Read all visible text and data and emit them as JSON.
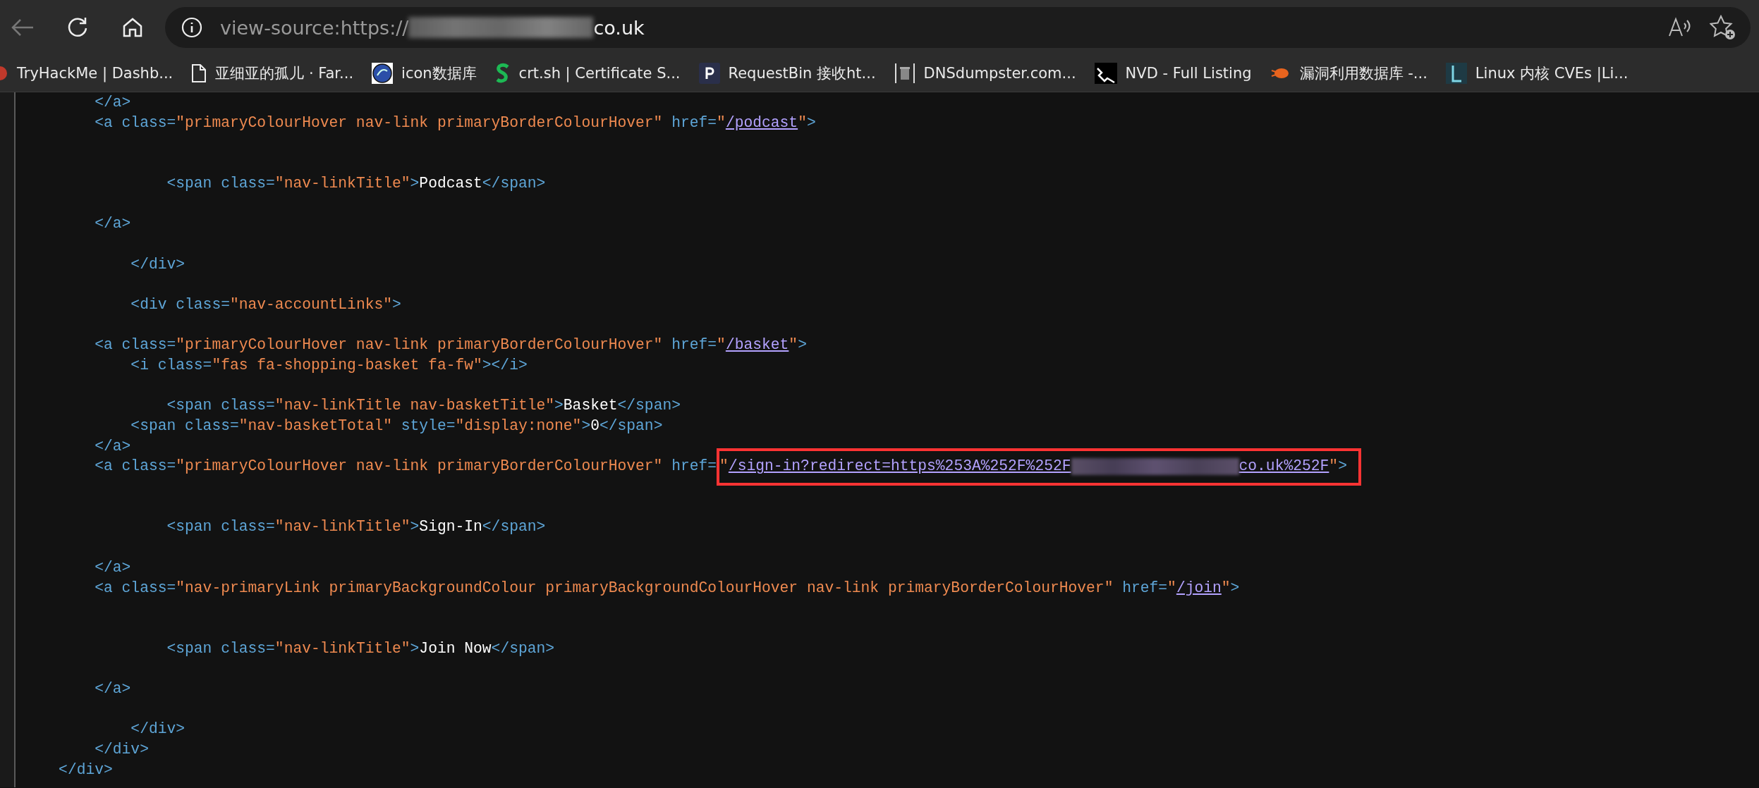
{
  "toolbar": {
    "address": {
      "scheme": "view-source:https:",
      "host_start": "//",
      "host_end": "co.uk"
    }
  },
  "bookmarks": [
    {
      "label": "TryHackMe | Dashb..."
    },
    {
      "label": "亚细亚的孤儿 · Far..."
    },
    {
      "label": "icon数据库"
    },
    {
      "label": "crt.sh | Certificate S..."
    },
    {
      "label": "RequestBin   接收ht..."
    },
    {
      "label": "DNSdumpster.com..."
    },
    {
      "label": "NVD - Full Listing"
    },
    {
      "label": "漏洞利用数据库 -..."
    },
    {
      "label": "Linux 内核 CVEs |Li..."
    }
  ],
  "source_lines": [
    {
      "kind": "code",
      "tokens": [
        {
          "kind": "markup",
          "text": "        </a>"
        }
      ]
    },
    {
      "kind": "code",
      "tokens": [
        {
          "kind": "markup",
          "text": "        <a class="
        },
        {
          "kind": "value",
          "text": "\"primaryColourHover nav-link primaryBorderColourHover\""
        },
        {
          "kind": "markup",
          "text": " href="
        },
        {
          "kind": "value",
          "text": "\""
        },
        {
          "kind": "link",
          "text": "/podcast"
        },
        {
          "kind": "value",
          "text": "\""
        },
        {
          "kind": "markup",
          "text": ">"
        }
      ]
    },
    {
      "kind": "blank"
    },
    {
      "kind": "blank"
    },
    {
      "kind": "code",
      "tokens": [
        {
          "kind": "markup",
          "text": "                <span class="
        },
        {
          "kind": "value",
          "text": "\"nav-linkTitle\""
        },
        {
          "kind": "markup",
          "text": ">"
        },
        {
          "kind": "text",
          "text": "Podcast"
        },
        {
          "kind": "markup",
          "text": "</span>"
        }
      ]
    },
    {
      "kind": "blank"
    },
    {
      "kind": "code",
      "tokens": [
        {
          "kind": "markup",
          "text": "        </a>"
        }
      ]
    },
    {
      "kind": "blank"
    },
    {
      "kind": "code",
      "tokens": [
        {
          "kind": "markup",
          "text": "            </div>"
        }
      ]
    },
    {
      "kind": "blank"
    },
    {
      "kind": "code",
      "tokens": [
        {
          "kind": "markup",
          "text": "            <div class="
        },
        {
          "kind": "value",
          "text": "\"nav-accountLinks\""
        },
        {
          "kind": "markup",
          "text": ">"
        }
      ]
    },
    {
      "kind": "blank"
    },
    {
      "kind": "code",
      "tokens": [
        {
          "kind": "markup",
          "text": "        <a class="
        },
        {
          "kind": "value",
          "text": "\"primaryColourHover nav-link primaryBorderColourHover\""
        },
        {
          "kind": "markup",
          "text": " href="
        },
        {
          "kind": "value",
          "text": "\""
        },
        {
          "kind": "link",
          "text": "/basket"
        },
        {
          "kind": "value",
          "text": "\""
        },
        {
          "kind": "markup",
          "text": ">"
        }
      ]
    },
    {
      "kind": "code",
      "tokens": [
        {
          "kind": "markup",
          "text": "            <i class="
        },
        {
          "kind": "value",
          "text": "\"fas fa-shopping-basket fa-fw\""
        },
        {
          "kind": "markup",
          "text": "></i>"
        }
      ]
    },
    {
      "kind": "blank"
    },
    {
      "kind": "code",
      "tokens": [
        {
          "kind": "markup",
          "text": "                <span class="
        },
        {
          "kind": "value",
          "text": "\"nav-linkTitle nav-basketTitle\""
        },
        {
          "kind": "markup",
          "text": ">"
        },
        {
          "kind": "text",
          "text": "Basket"
        },
        {
          "kind": "markup",
          "text": "</span>"
        }
      ]
    },
    {
      "kind": "code",
      "tokens": [
        {
          "kind": "markup",
          "text": "            <span class="
        },
        {
          "kind": "value",
          "text": "\"nav-basketTotal\""
        },
        {
          "kind": "markup",
          "text": " style="
        },
        {
          "kind": "value",
          "text": "\"display:none\""
        },
        {
          "kind": "markup",
          "text": ">"
        },
        {
          "kind": "text",
          "text": "0"
        },
        {
          "kind": "markup",
          "text": "</span>"
        }
      ]
    },
    {
      "kind": "code",
      "tokens": [
        {
          "kind": "markup",
          "text": "        </a>"
        }
      ]
    },
    {
      "kind": "code",
      "tokens": [
        {
          "kind": "markup",
          "text": "        <a class="
        },
        {
          "kind": "value",
          "text": "\"primaryColourHover nav-link primaryBorderColourHover\""
        },
        {
          "kind": "markup",
          "text": " href="
        },
        {
          "kind": "value",
          "text": "\"",
          "boxed": true
        },
        {
          "kind": "link",
          "text": "/sign-in?redirect=https%253A%252F%252F",
          "boxed": true
        },
        {
          "kind": "redacted",
          "boxed": true
        },
        {
          "kind": "link",
          "text": "co.uk%252F",
          "boxed": true
        },
        {
          "kind": "value",
          "text": "\"",
          "boxed": true
        },
        {
          "kind": "markup",
          "text": ">",
          "boxed": true
        }
      ]
    },
    {
      "kind": "blank"
    },
    {
      "kind": "blank"
    },
    {
      "kind": "code",
      "tokens": [
        {
          "kind": "markup",
          "text": "                <span class="
        },
        {
          "kind": "value",
          "text": "\"nav-linkTitle\""
        },
        {
          "kind": "markup",
          "text": ">"
        },
        {
          "kind": "text",
          "text": "Sign-In"
        },
        {
          "kind": "markup",
          "text": "</span>"
        }
      ]
    },
    {
      "kind": "blank"
    },
    {
      "kind": "code",
      "tokens": [
        {
          "kind": "markup",
          "text": "        </a>"
        }
      ]
    },
    {
      "kind": "code",
      "tokens": [
        {
          "kind": "markup",
          "text": "        <a class="
        },
        {
          "kind": "value",
          "text": "\"nav-primaryLink primaryBackgroundColour primaryBackgroundColourHover nav-link primaryBorderColourHover\""
        },
        {
          "kind": "markup",
          "text": " href="
        },
        {
          "kind": "value",
          "text": "\""
        },
        {
          "kind": "link",
          "text": "/join"
        },
        {
          "kind": "value",
          "text": "\""
        },
        {
          "kind": "markup",
          "text": ">"
        }
      ]
    },
    {
      "kind": "blank"
    },
    {
      "kind": "blank"
    },
    {
      "kind": "code",
      "tokens": [
        {
          "kind": "markup",
          "text": "                <span class="
        },
        {
          "kind": "value",
          "text": "\"nav-linkTitle\""
        },
        {
          "kind": "markup",
          "text": ">"
        },
        {
          "kind": "text",
          "text": "Join Now"
        },
        {
          "kind": "markup",
          "text": "</span>"
        }
      ]
    },
    {
      "kind": "blank"
    },
    {
      "kind": "code",
      "tokens": [
        {
          "kind": "markup",
          "text": "        </a>"
        }
      ]
    },
    {
      "kind": "blank"
    },
    {
      "kind": "code",
      "tokens": [
        {
          "kind": "markup",
          "text": "            </div>"
        }
      ]
    },
    {
      "kind": "code",
      "tokens": [
        {
          "kind": "markup",
          "text": "        </div>"
        }
      ]
    },
    {
      "kind": "code",
      "tokens": [
        {
          "kind": "markup",
          "text": "    </div>"
        }
      ]
    }
  ]
}
